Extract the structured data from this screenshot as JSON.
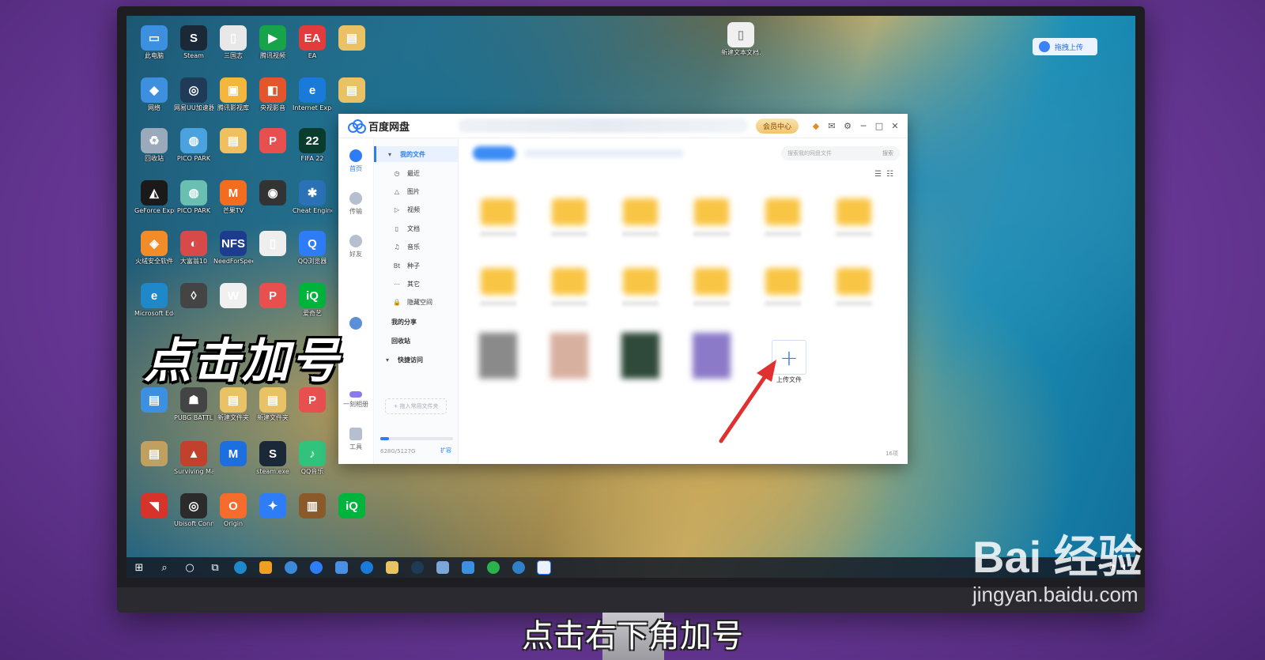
{
  "desktop": {
    "icons": [
      {
        "label": "此电脑",
        "col": 0,
        "row": 0,
        "color": "#3d8fe0",
        "glyph": "▭"
      },
      {
        "label": "Steam",
        "col": 1,
        "row": 0,
        "color": "#1b2838",
        "glyph": "S"
      },
      {
        "label": "三国志",
        "col": 2,
        "row": 0,
        "color": "#e8e8e8",
        "glyph": "▯"
      },
      {
        "label": "腾讯视频",
        "col": 3,
        "row": 0,
        "color": "#16a34a",
        "glyph": "▶"
      },
      {
        "label": "EA",
        "col": 4,
        "row": 0,
        "color": "#e23b3b",
        "glyph": "EA"
      },
      {
        "label": "",
        "col": 5,
        "row": 0,
        "color": "#e9c266",
        "glyph": "▤"
      },
      {
        "label": "网络",
        "col": 0,
        "row": 1,
        "color": "#3d8fe0",
        "glyph": "◆"
      },
      {
        "label": "网易UU加速器",
        "col": 1,
        "row": 1,
        "color": "#1f3b57",
        "glyph": "◎"
      },
      {
        "label": "腾讯影视库",
        "col": 2,
        "row": 1,
        "color": "#f5b63e",
        "glyph": "▣"
      },
      {
        "label": "央视影音",
        "col": 3,
        "row": 1,
        "color": "#e4552b",
        "glyph": "◧"
      },
      {
        "label": "Internet Explorer",
        "col": 4,
        "row": 1,
        "color": "#1a7ad9",
        "glyph": "e"
      },
      {
        "label": "",
        "col": 5,
        "row": 1,
        "color": "#e9c266",
        "glyph": "▤"
      },
      {
        "label": "回收站",
        "col": 0,
        "row": 2,
        "color": "#9aaabb",
        "glyph": "♻"
      },
      {
        "label": "PICO PARK",
        "col": 1,
        "row": 2,
        "color": "#4aa3df",
        "glyph": "◍"
      },
      {
        "label": "",
        "col": 2,
        "row": 2,
        "color": "#f0c060",
        "glyph": "▤"
      },
      {
        "label": "",
        "col": 3,
        "row": 2,
        "color": "#e85050",
        "glyph": "P"
      },
      {
        "label": "FIFA 22",
        "col": 4,
        "row": 2,
        "color": "#0b3d2e",
        "glyph": "22"
      },
      {
        "label": "GeForce Experience",
        "col": 0,
        "row": 3,
        "color": "#1a1a1a",
        "glyph": "◭"
      },
      {
        "label": "PICO PARK",
        "col": 1,
        "row": 3,
        "color": "#6ac0b0",
        "glyph": "◍"
      },
      {
        "label": "芒果TV",
        "col": 2,
        "row": 3,
        "color": "#f36d21",
        "glyph": "M"
      },
      {
        "label": "",
        "col": 3,
        "row": 3,
        "color": "#333",
        "glyph": "◉"
      },
      {
        "label": "Cheat Engine",
        "col": 4,
        "row": 3,
        "color": "#2a72b5",
        "glyph": "✱"
      },
      {
        "label": "火绒安全软件",
        "col": 0,
        "row": 4,
        "color": "#f28c28",
        "glyph": "◈"
      },
      {
        "label": "大富翁10",
        "col": 1,
        "row": 4,
        "color": "#d84a4a",
        "glyph": "◐"
      },
      {
        "label": "NeedForSpeed",
        "col": 2,
        "row": 4,
        "color": "#1d3c8f",
        "glyph": "NFS"
      },
      {
        "label": "",
        "col": 3,
        "row": 4,
        "color": "#eeeeee",
        "glyph": "▯"
      },
      {
        "label": "QQ浏览器",
        "col": 4,
        "row": 4,
        "color": "#2f7df6",
        "glyph": "Q"
      },
      {
        "label": "Microsoft Edge",
        "col": 0,
        "row": 5,
        "color": "#1e88c8",
        "glyph": "e"
      },
      {
        "label": "",
        "col": 1,
        "row": 5,
        "color": "#444",
        "glyph": "◊"
      },
      {
        "label": "",
        "col": 2,
        "row": 5,
        "color": "#f0f0f0",
        "glyph": "W"
      },
      {
        "label": "",
        "col": 3,
        "row": 5,
        "color": "#e85050",
        "glyph": "P"
      },
      {
        "label": "爱奇艺",
        "col": 4,
        "row": 5,
        "color": "#00b33c",
        "glyph": "iQ"
      },
      {
        "label": "",
        "col": 0,
        "row": 7,
        "color": "#3d8fe0",
        "glyph": "▤"
      },
      {
        "label": "PUBG BATTLEGR...",
        "col": 1,
        "row": 7,
        "color": "#444",
        "glyph": "☗"
      },
      {
        "label": "新建文件夹",
        "col": 2,
        "row": 7,
        "color": "#e9c266",
        "glyph": "▤"
      },
      {
        "label": "新建文件夹",
        "col": 3,
        "row": 7,
        "color": "#e9c266",
        "glyph": "▤"
      },
      {
        "label": "",
        "col": 4,
        "row": 7,
        "color": "#e85050",
        "glyph": "P"
      },
      {
        "label": "",
        "col": 0,
        "row": 8,
        "color": "#c0a060",
        "glyph": "▤"
      },
      {
        "label": "Surviving Mars",
        "col": 1,
        "row": 8,
        "color": "#c2412d",
        "glyph": "▲"
      },
      {
        "label": "",
        "col": 2,
        "row": 8,
        "color": "#1d6fe0",
        "glyph": "M"
      },
      {
        "label": "steam.exe",
        "col": 3,
        "row": 8,
        "color": "#1b2838",
        "glyph": "S"
      },
      {
        "label": "QQ音乐",
        "col": 4,
        "row": 8,
        "color": "#31c27c",
        "glyph": "♪"
      },
      {
        "label": "",
        "col": 0,
        "row": 9,
        "color": "#d6332a",
        "glyph": "◥"
      },
      {
        "label": "Ubisoft Connect",
        "col": 1,
        "row": 9,
        "color": "#2b2b2b",
        "glyph": "◎"
      },
      {
        "label": "Origin",
        "col": 2,
        "row": 9,
        "color": "#f56c2d",
        "glyph": "O"
      },
      {
        "label": "",
        "col": 3,
        "row": 9,
        "color": "#2f7df6",
        "glyph": "✦"
      },
      {
        "label": "",
        "col": 4,
        "row": 9,
        "color": "#8a5a2a",
        "glyph": "▥"
      },
      {
        "label": "",
        "col": 5,
        "row": 9,
        "color": "#00b33c",
        "glyph": "iQ"
      }
    ],
    "right_icon": {
      "label": "新建文本文档.txt"
    },
    "cloud_upload_label": "拖拽上传"
  },
  "app": {
    "name": "百度网盘",
    "vip_label": "会员中心",
    "rail": [
      {
        "label": "首页",
        "active": true
      },
      {
        "label": "传输",
        "active": false
      },
      {
        "label": "好友",
        "active": false
      },
      {
        "label": "",
        "active": false
      },
      {
        "label": "一刻相册",
        "active": false
      },
      {
        "label": "工具",
        "active": false
      }
    ],
    "nav": {
      "my_files": "我的文件",
      "recent": "最近",
      "pictures": "图片",
      "videos": "视频",
      "documents": "文档",
      "music": "音乐",
      "torrents": "种子",
      "others": "其它",
      "hidden": "隐藏空间",
      "my_share": "我的分享",
      "recycle": "回收站",
      "quick_access": "快捷访问",
      "add_folder": "+ 拖入常用文件夹",
      "quota": "628G/5127G",
      "expand": "扩容",
      "quota_fraction": 0.12
    },
    "search_placeholder": "搜索我的网盘文件",
    "search_button": "搜索",
    "upload_label": "上传文件",
    "item_count": "16项"
  },
  "overlay": {
    "caption": "点击加号",
    "subtitle": "点击右下角加号"
  },
  "watermark": {
    "line1": "Bai  经验",
    "line2": "jingyan.baidu.com"
  }
}
